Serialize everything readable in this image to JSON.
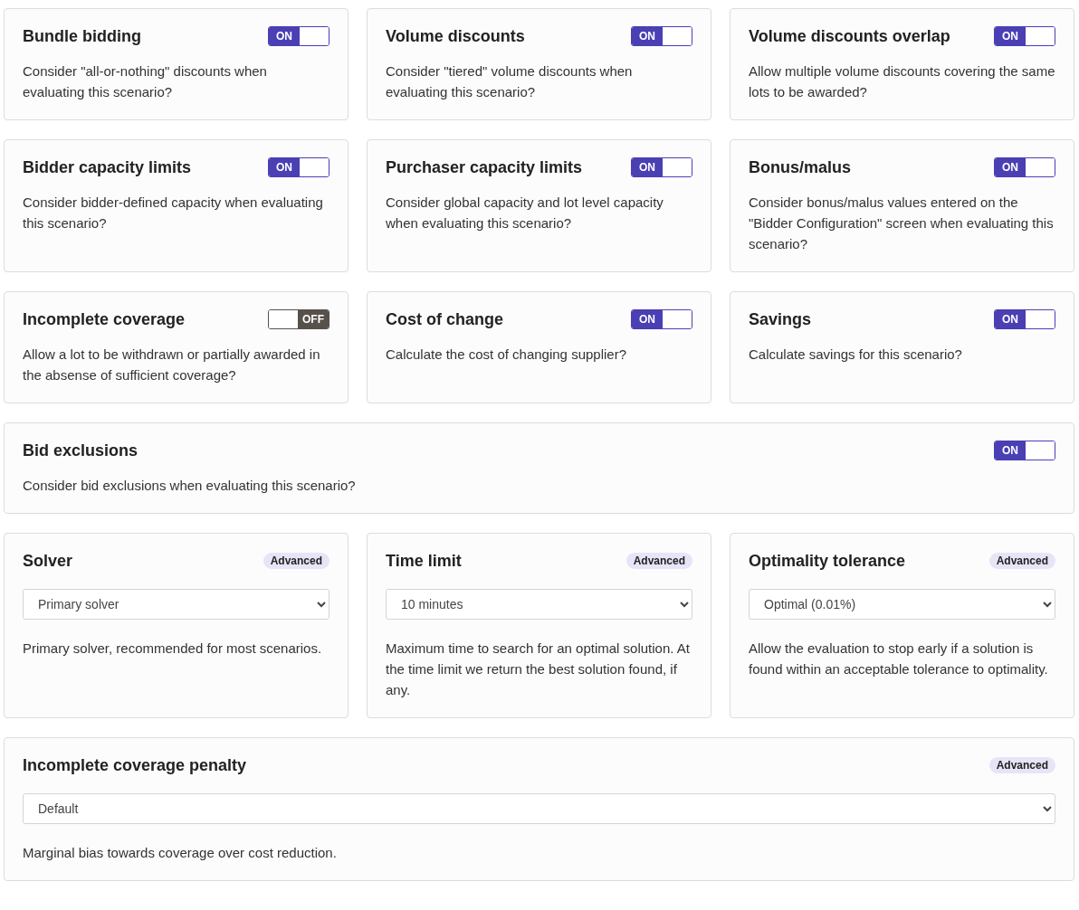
{
  "rows": [
    {
      "cards": [
        {
          "kind": "toggle",
          "title": "Bundle bidding",
          "on": true,
          "switch_label": "ON",
          "description": "Consider \"all-or-nothing\" discounts when evaluating this scenario?"
        },
        {
          "kind": "toggle",
          "title": "Volume discounts",
          "on": true,
          "switch_label": "ON",
          "description": "Consider \"tiered\" volume discounts when evaluating this scenario?"
        },
        {
          "kind": "toggle",
          "title": "Volume discounts overlap",
          "on": true,
          "switch_label": "ON",
          "description": "Allow multiple volume discounts covering the same lots to be awarded?"
        }
      ]
    },
    {
      "cards": [
        {
          "kind": "toggle",
          "title": "Bidder capacity limits",
          "on": true,
          "switch_label": "ON",
          "description": "Consider bidder-defined capacity when evaluating this scenario?"
        },
        {
          "kind": "toggle",
          "title": "Purchaser capacity limits",
          "on": true,
          "switch_label": "ON",
          "description": "Consider global capacity and lot level capacity when evaluating this scenario?"
        },
        {
          "kind": "toggle",
          "title": "Bonus/malus",
          "on": true,
          "switch_label": "ON",
          "description": "Consider bonus/malus values entered on the \"Bidder Configuration\" screen when evaluating this scenario?"
        }
      ]
    },
    {
      "cards": [
        {
          "kind": "toggle",
          "title": "Incomplete coverage",
          "on": false,
          "switch_label": "OFF",
          "description": "Allow a lot to be withdrawn or partially awarded in the absense of sufficient coverage?"
        },
        {
          "kind": "toggle",
          "title": "Cost of change",
          "on": true,
          "switch_label": "ON",
          "description": "Calculate the cost of changing supplier?"
        },
        {
          "kind": "toggle",
          "title": "Savings",
          "on": true,
          "switch_label": "ON",
          "description": "Calculate savings for this scenario?"
        }
      ]
    },
    {
      "cards": [
        {
          "kind": "toggle",
          "title": "Bid exclusions",
          "on": true,
          "switch_label": "ON",
          "description": "Consider bid exclusions when evaluating this scenario?"
        }
      ]
    },
    {
      "cards": [
        {
          "kind": "select",
          "title": "Solver",
          "badge": "Advanced",
          "value": "Primary solver",
          "description": "Primary solver, recommended for most scenarios."
        },
        {
          "kind": "select",
          "title": "Time limit",
          "badge": "Advanced",
          "value": "10 minutes",
          "description": "Maximum time to search for an optimal solution. At the time limit we return the best solution found, if any."
        },
        {
          "kind": "select",
          "title": "Optimality tolerance",
          "badge": "Advanced",
          "value": "Optimal (0.01%)",
          "description": "Allow the evaluation to stop early if a solution is found within an acceptable tolerance to optimality."
        }
      ]
    },
    {
      "cards": [
        {
          "kind": "select",
          "title": "Incomplete coverage penalty",
          "badge": "Advanced",
          "value": "Default",
          "description": "Marginal bias towards coverage over cost reduction."
        }
      ]
    }
  ]
}
